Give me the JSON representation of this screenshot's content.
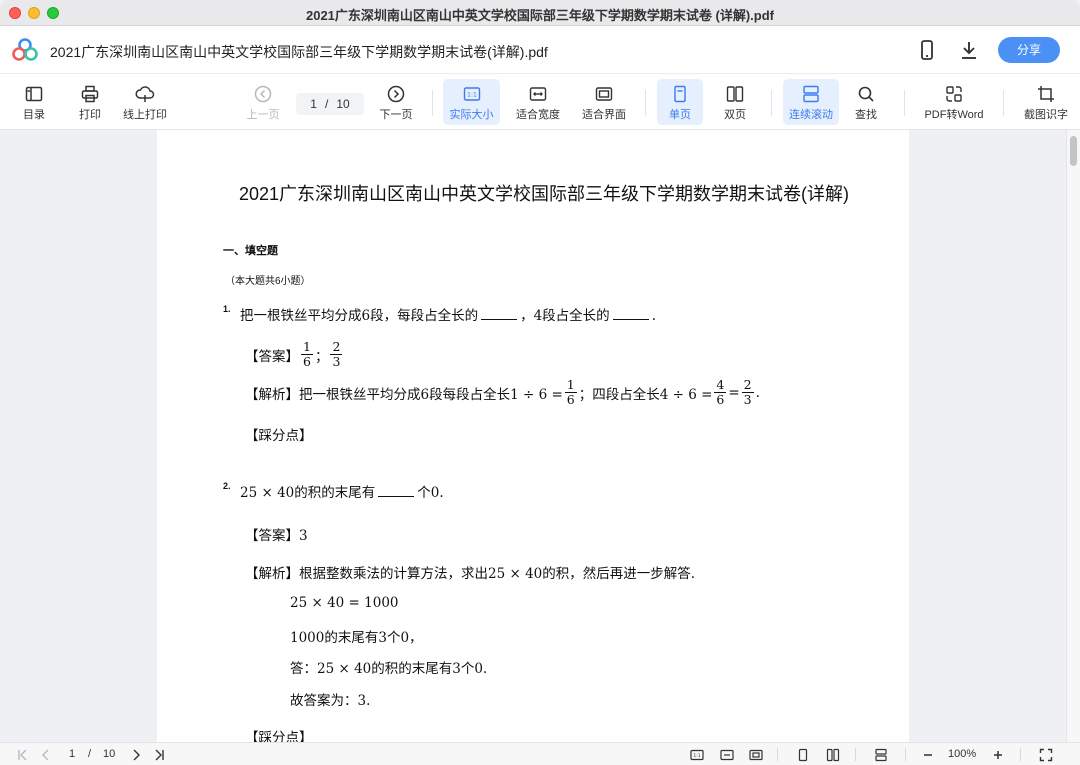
{
  "window": {
    "title": "2021广东深圳南山区南山中英文学校国际部三年级下学期数学期末试卷 (详解).pdf"
  },
  "header": {
    "doc_title": "2021广东深圳南山区南山中英文学校国际部三年级下学期数学期末试卷(详解).pdf",
    "share_label": "分享"
  },
  "toolbar": {
    "toc": "目录",
    "print": "打印",
    "online_print": "线上打印",
    "prev_page": "上一页",
    "next_page": "下一页",
    "current_page": "1",
    "page_sep": "/",
    "total_pages": "10",
    "actual_size": "实际大小",
    "fit_width": "适合宽度",
    "fit_screen": "适合界面",
    "single_page": "单页",
    "double_page": "双页",
    "continuous_scroll": "连续滚动",
    "find": "查找",
    "pdf_to_word": "PDF转Word",
    "ocr": "截图识字"
  },
  "document": {
    "heading": "2021广东深圳南山区南山中英文学校国际部三年级下学期数学期末试卷(详解)",
    "section_title": "一、填空题",
    "section_note": "（本大题共6小题）",
    "q1": {
      "number": "1.",
      "text_a": "把一根铁丝平均分成6段，每段占全长的",
      "text_b": "，4段占全长的",
      "text_c": ".",
      "answer_label": "【答案】",
      "ans_f1_num": "1",
      "ans_f1_den": "6",
      "ans_sep": "；",
      "ans_f2_num": "2",
      "ans_f2_den": "3",
      "analysis_label": "【解析】",
      "analysis_a": "把一根铁丝平均分成6段每段占全长1 ÷ 6 =",
      "an_f1_num": "1",
      "an_f1_den": "6",
      "analysis_b": "；四段占全长4 ÷ 6 =",
      "an_f2_num": "4",
      "an_f2_den": "6",
      "analysis_eq": "=",
      "an_f3_num": "2",
      "an_f3_den": "3",
      "analysis_end": ".",
      "points_label": "【踩分点】"
    },
    "q2": {
      "number": "2.",
      "text_a": "25 × 40的积的末尾有",
      "text_b": "个0.",
      "answer_label": "【答案】",
      "answer_value": "3",
      "analysis_label": "【解析】",
      "analysis_text": "根据整数乘法的计算方法，求出25 × 40的积，然后再进一步解答.",
      "step1": "25 × 40 = 1000",
      "step2": "1000的末尾有3个0，",
      "step3": "答：25 × 40的积的末尾有3个0.",
      "step4": "故答案为：3.",
      "points_label": "【踩分点】"
    }
  },
  "statusbar": {
    "current_page": "1",
    "page_sep": "/",
    "total_pages": "10",
    "zoom": "100%"
  }
}
